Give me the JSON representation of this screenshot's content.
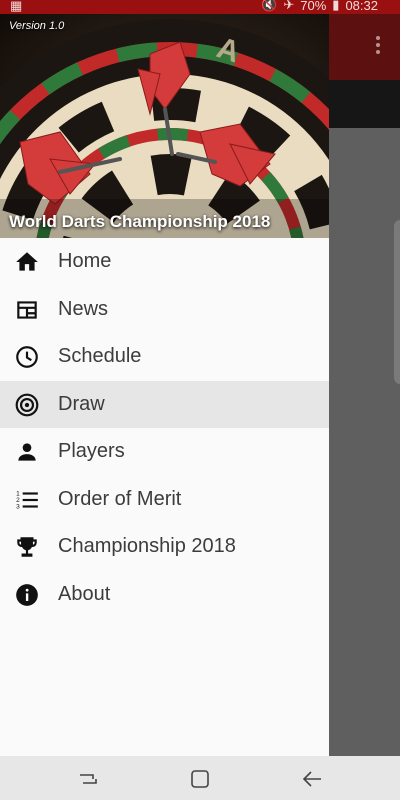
{
  "status_bar": {
    "battery": "70%",
    "time": "08:32"
  },
  "drawer": {
    "version": "Version 1.0",
    "title": "World Darts Championship 2018",
    "selected_index": 3,
    "items": [
      {
        "label": "Home",
        "icon": "home-icon"
      },
      {
        "label": "News",
        "icon": "news-icon"
      },
      {
        "label": "Schedule",
        "icon": "clock-icon"
      },
      {
        "label": "Draw",
        "icon": "target-icon"
      },
      {
        "label": "Players",
        "icon": "person-icon"
      },
      {
        "label": "Order of Merit",
        "icon": "numbered-list-icon"
      },
      {
        "label": "Championship 2018",
        "icon": "trophy-icon"
      },
      {
        "label": "About",
        "icon": "info-icon"
      }
    ]
  },
  "colors": {
    "brand_red": "#9a1010",
    "selected_bg": "#e6e6e6"
  }
}
